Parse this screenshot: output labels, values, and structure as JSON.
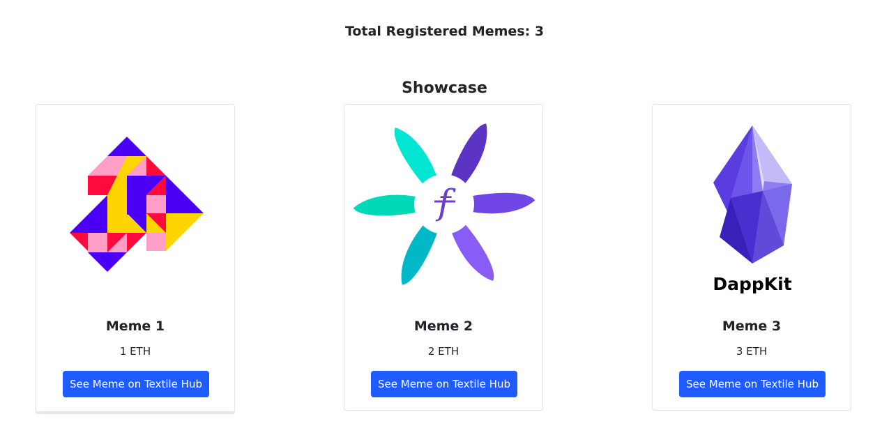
{
  "header": {
    "total_label": "Total Registered Memes: 3"
  },
  "showcase": {
    "title": "Showcase",
    "memes": [
      {
        "title": "Meme 1",
        "price": "1 ETH",
        "button_label": "See Meme on Textile Hub",
        "image": "geometric-triangles-logo"
      },
      {
        "title": "Meme 2",
        "price": "2 ETH",
        "button_label": "See Meme on Textile Hub",
        "image": "filecoin-flower-logo"
      },
      {
        "title": "Meme 3",
        "price": "3 ETH",
        "button_label": "See Meme on Textile Hub",
        "image": "dappkit-crystal-logo",
        "logo_text": "DappKit"
      }
    ]
  },
  "colors": {
    "button": "#1f5cff",
    "card_border": "#dfe2e6",
    "text": "#212529"
  }
}
